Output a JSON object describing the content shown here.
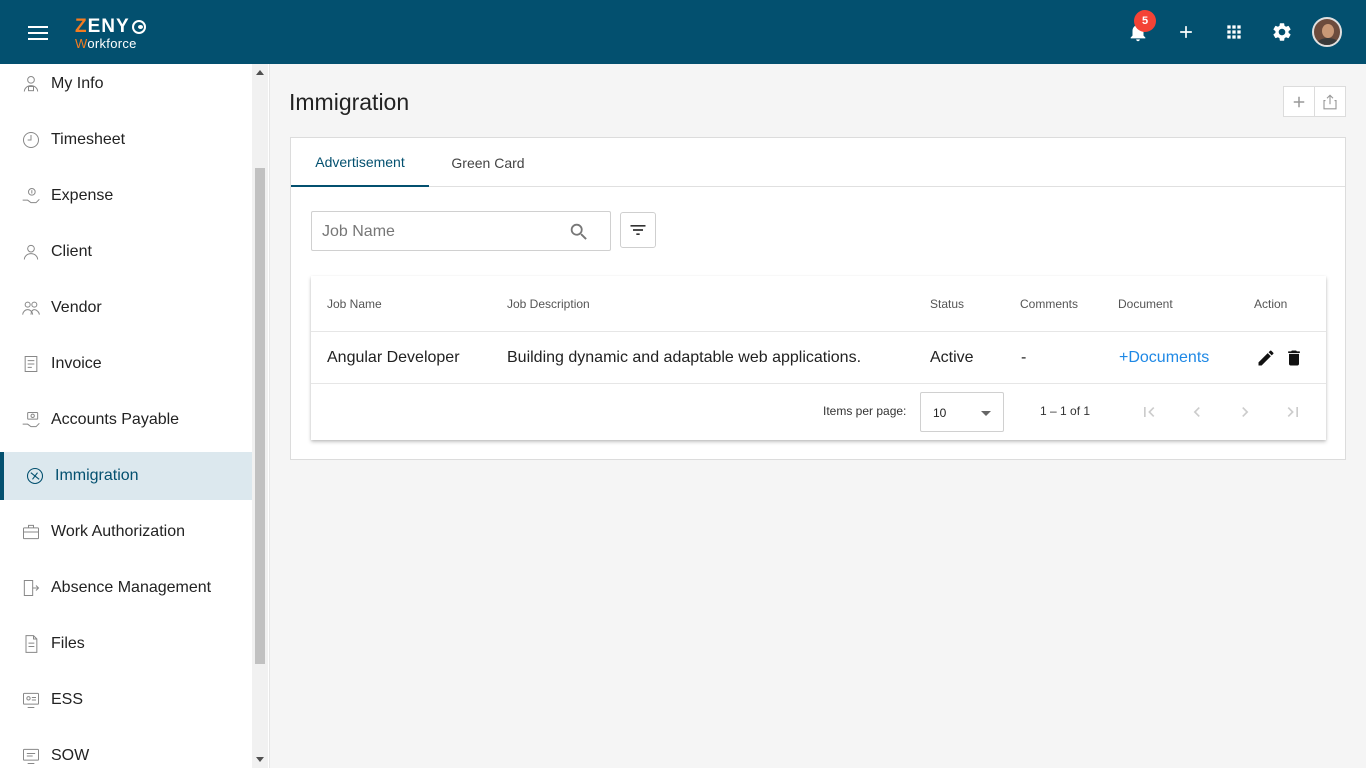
{
  "app": {
    "logo_top_prefix": "Z",
    "logo_top": "ENY",
    "logo_bottom_prefix": "W",
    "logo_bottom": "orkforce",
    "notification_count": "5"
  },
  "sidebar": {
    "items": [
      {
        "label": "My Info",
        "icon": "person-id-icon"
      },
      {
        "label": "Timesheet",
        "icon": "clock-icon"
      },
      {
        "label": "Expense",
        "icon": "money-hand-icon"
      },
      {
        "label": "Client",
        "icon": "user-icon"
      },
      {
        "label": "Vendor",
        "icon": "group-icon"
      },
      {
        "label": "Invoice",
        "icon": "invoice-icon"
      },
      {
        "label": "Accounts Payable",
        "icon": "payable-hand-icon"
      },
      {
        "label": "Immigration",
        "icon": "globe-plane-icon",
        "active": true
      },
      {
        "label": "Work Authorization",
        "icon": "briefcase-icon"
      },
      {
        "label": "Absence Management",
        "icon": "exit-door-icon"
      },
      {
        "label": "Files",
        "icon": "file-icon"
      },
      {
        "label": "ESS",
        "icon": "ess-icon"
      },
      {
        "label": "SOW",
        "icon": "sow-icon"
      }
    ]
  },
  "main": {
    "title": "Immigration",
    "tabs": [
      {
        "label": "Advertisement",
        "active": true
      },
      {
        "label": "Green Card",
        "active": false
      }
    ],
    "search": {
      "placeholder": "Job Name",
      "value": ""
    },
    "table": {
      "columns": [
        "Job Name",
        "Job Description",
        "Status",
        "Comments",
        "Document",
        "Action"
      ],
      "rows": [
        {
          "job_name": "Angular Developer",
          "job_description": "Building dynamic and adaptable web applications.",
          "status": "Active",
          "comments": "-",
          "document": "+Documents"
        }
      ]
    },
    "paginator": {
      "items_per_page_label": "Items per page:",
      "page_size": "10",
      "range": "1 – 1 of 1"
    }
  },
  "colors": {
    "header": "#03506f",
    "accent": "#03506f",
    "link": "#1e88e5",
    "badge": "#f44336",
    "logo_orange": "#f47c20"
  }
}
